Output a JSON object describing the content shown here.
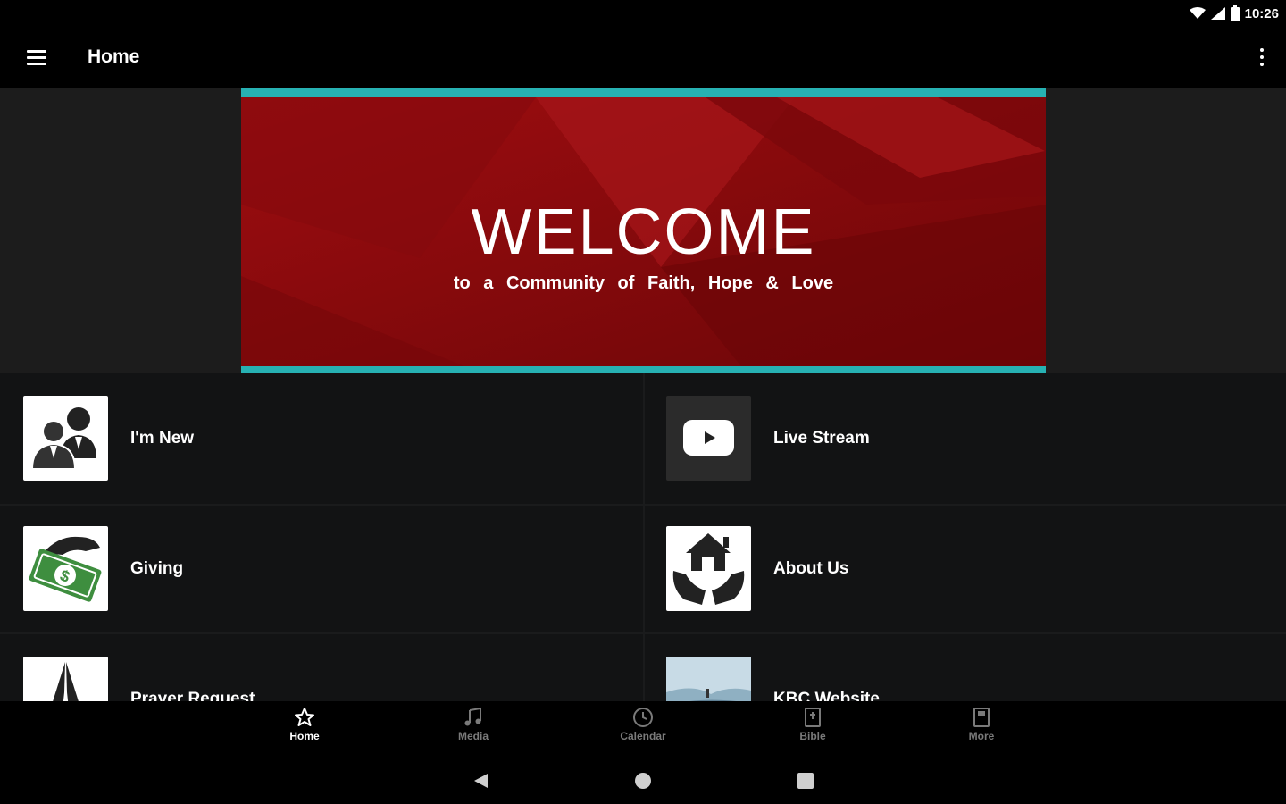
{
  "status_bar": {
    "time": "10:26",
    "icons": [
      "wifi-icon",
      "signal-icon",
      "battery-icon"
    ]
  },
  "app_bar": {
    "title": "Home",
    "menu_icon": "hamburger-menu-icon",
    "overflow_icon": "more-vert-icon"
  },
  "banner": {
    "title": "WELCOME",
    "subtitle": "to a Community of Faith, Hope & Love",
    "colors": {
      "background": "#8d0a0c",
      "border": "#27b1b3"
    }
  },
  "tiles": [
    {
      "label": "I'm New",
      "icon": "people-icon"
    },
    {
      "label": "Live Stream",
      "icon": "play-icon"
    },
    {
      "label": "Giving",
      "icon": "money-hand-icon"
    },
    {
      "label": "About Us",
      "icon": "house-hands-icon"
    },
    {
      "label": "Prayer Request",
      "icon": "praying-hands-icon"
    },
    {
      "label": "KBC Website",
      "icon": "landscape-icon"
    }
  ],
  "bottom_nav": {
    "items": [
      {
        "label": "Home",
        "icon": "star-icon",
        "active": true
      },
      {
        "label": "Media",
        "icon": "music-note-icon",
        "active": false
      },
      {
        "label": "Calendar",
        "icon": "clock-icon",
        "active": false
      },
      {
        "label": "Bible",
        "icon": "bible-icon",
        "active": false
      },
      {
        "label": "More",
        "icon": "book-icon",
        "active": false
      }
    ]
  },
  "system_nav": {
    "icons": [
      "back-icon",
      "home-icon",
      "recents-icon"
    ]
  }
}
